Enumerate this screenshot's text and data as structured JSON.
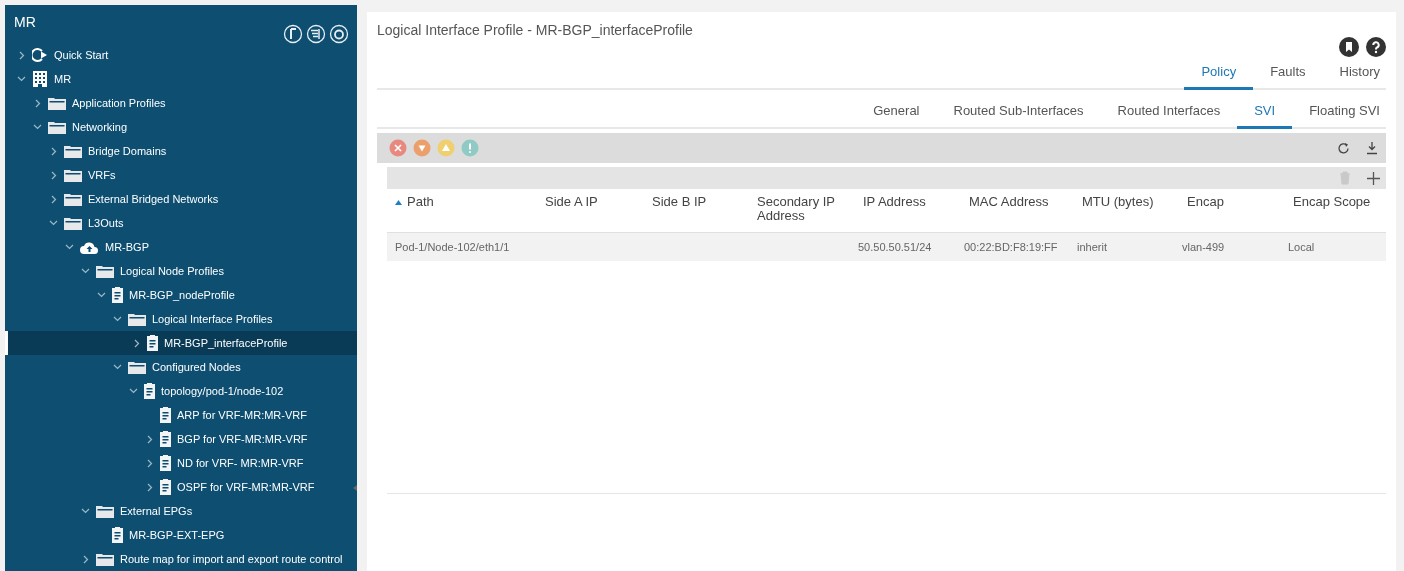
{
  "sidebar": {
    "title": "MR",
    "tree": [
      {
        "label": "Quick Start",
        "kind": "start",
        "expanded": false,
        "selected": false
      },
      {
        "label": "MR",
        "kind": "tenant",
        "expanded": true,
        "selected": false,
        "children": [
          {
            "label": "Application Profiles",
            "kind": "folder",
            "expanded": false,
            "selected": false
          },
          {
            "label": "Networking",
            "kind": "folder",
            "expanded": true,
            "selected": false,
            "children": [
              {
                "label": "Bridge Domains",
                "kind": "folder",
                "expanded": false,
                "selected": false
              },
              {
                "label": "VRFs",
                "kind": "folder",
                "expanded": false,
                "selected": false
              },
              {
                "label": "External Bridged Networks",
                "kind": "folder",
                "expanded": false,
                "selected": false
              },
              {
                "label": "L3Outs",
                "kind": "folder",
                "expanded": true,
                "selected": false,
                "children": [
                  {
                    "label": "MR-BGP",
                    "kind": "cloud",
                    "expanded": true,
                    "selected": false,
                    "children": [
                      {
                        "label": "Logical Node Profiles",
                        "kind": "folder",
                        "expanded": true,
                        "selected": false,
                        "children": [
                          {
                            "label": "MR-BGP_nodeProfile",
                            "kind": "doc",
                            "expanded": true,
                            "selected": false,
                            "children": [
                              {
                                "label": "Logical Interface Profiles",
                                "kind": "folder",
                                "expanded": true,
                                "selected": false,
                                "children": [
                                  {
                                    "label": "MR-BGP_interfaceProfile",
                                    "kind": "doc",
                                    "expanded": false,
                                    "selected": true
                                  }
                                ]
                              },
                              {
                                "label": "Configured Nodes",
                                "kind": "folder",
                                "expanded": true,
                                "selected": false,
                                "children": [
                                  {
                                    "label": "topology/pod-1/node-102",
                                    "kind": "doc",
                                    "expanded": true,
                                    "selected": false,
                                    "children": [
                                      {
                                        "label": "ARP for VRF-MR:MR-VRF",
                                        "kind": "doc",
                                        "selected": false
                                      },
                                      {
                                        "label": "BGP for VRF-MR:MR-VRF",
                                        "kind": "doc",
                                        "expanded": false,
                                        "selected": false
                                      },
                                      {
                                        "label": "ND for VRF- MR:MR-VRF",
                                        "kind": "doc",
                                        "expanded": false,
                                        "selected": false
                                      },
                                      {
                                        "label": "OSPF for VRF-MR:MR-VRF",
                                        "kind": "doc",
                                        "expanded": false,
                                        "selected": false
                                      }
                                    ]
                                  }
                                ]
                              }
                            ]
                          }
                        ]
                      },
                      {
                        "label": "External EPGs",
                        "kind": "folder",
                        "expanded": true,
                        "selected": false,
                        "children": [
                          {
                            "label": "MR-BGP-EXT-EPG",
                            "kind": "doc",
                            "selected": false
                          }
                        ]
                      },
                      {
                        "label": "Route map for import and export route control",
                        "kind": "folder",
                        "expanded": false,
                        "selected": false
                      }
                    ]
                  }
                ]
              }
            ]
          }
        ]
      }
    ]
  },
  "header": {
    "title": "Logical Interface Profile - MR-BGP_interfaceProfile"
  },
  "tabs": [
    {
      "label": "Policy",
      "selected": true
    },
    {
      "label": "Faults",
      "selected": false
    },
    {
      "label": "History",
      "selected": false
    }
  ],
  "subtabs": [
    {
      "label": "General",
      "selected": false
    },
    {
      "label": "Routed Sub-Interfaces",
      "selected": false
    },
    {
      "label": "Routed Interfaces",
      "selected": false
    },
    {
      "label": "SVI",
      "selected": true
    },
    {
      "label": "Floating SVI",
      "selected": false
    }
  ],
  "fault_filters": [
    {
      "kind": "critical",
      "color": "#e8897f"
    },
    {
      "kind": "major",
      "color": "#eba06b"
    },
    {
      "kind": "minor",
      "color": "#f0cf6e"
    },
    {
      "kind": "warning",
      "color": "#8fcbc4"
    }
  ],
  "table": {
    "delete_disabled": true,
    "columns": [
      {
        "label": "Path",
        "sorted": true
      },
      {
        "label": "Side A IP",
        "sorted": false
      },
      {
        "label": "Side B IP",
        "sorted": false
      },
      {
        "label": "Secondary IP Address",
        "sorted": false
      },
      {
        "label": "IP Address",
        "sorted": false
      },
      {
        "label": "MAC Address",
        "sorted": false
      },
      {
        "label": "MTU (bytes)",
        "sorted": false
      },
      {
        "label": "Encap",
        "sorted": false
      },
      {
        "label": "Encap Scope",
        "sorted": false
      }
    ],
    "rows": [
      [
        "Pod-1/Node-102/eth1/1",
        "",
        "",
        "",
        "50.50.50.51/24",
        "00:22:BD:F8:19:FF",
        "inherit",
        "vlan-499",
        "Local"
      ]
    ]
  }
}
